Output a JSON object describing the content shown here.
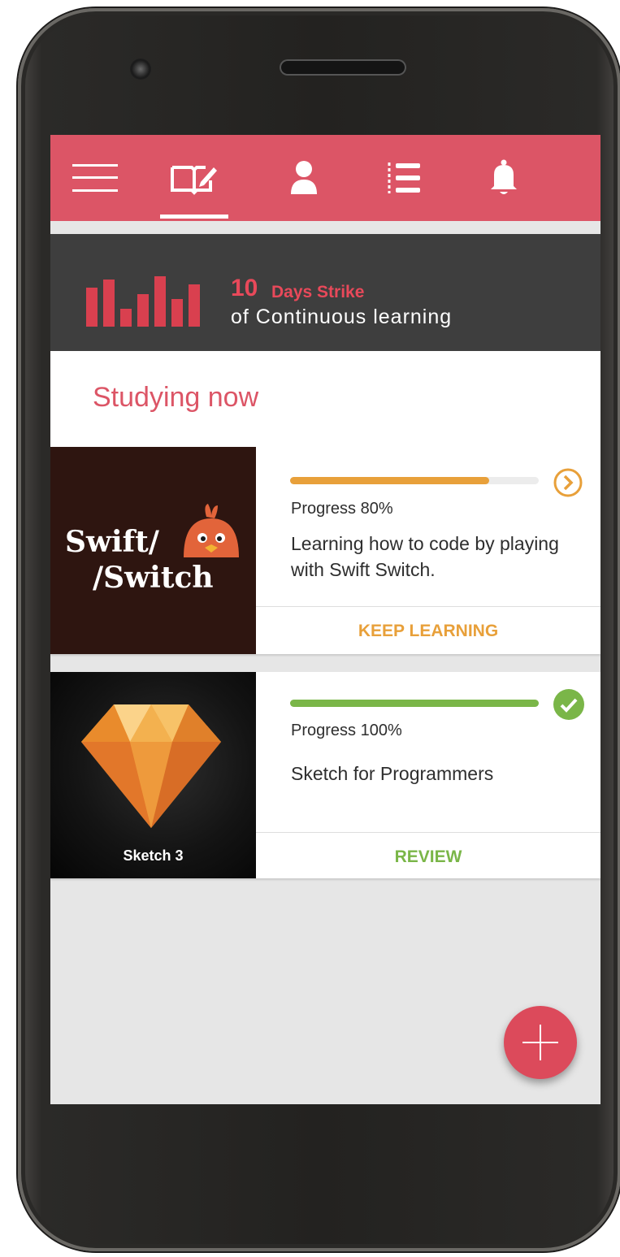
{
  "colors": {
    "brand": "#dc5566",
    "orange_accent": "#e8a03a",
    "green_accent": "#7ab648",
    "dark_banner": "#3e3e3e"
  },
  "nav": {
    "items": [
      {
        "icon": "hamburger-menu-icon",
        "selected": false
      },
      {
        "icon": "open-book-edit-icon",
        "selected": true
      },
      {
        "icon": "user-icon",
        "selected": false
      },
      {
        "icon": "numbered-list-icon",
        "selected": false
      },
      {
        "icon": "bell-icon",
        "selected": false
      }
    ]
  },
  "streak": {
    "icon": "bar-chart-icon",
    "count": "10",
    "days_text": "Days Strike",
    "subtitle": "of Continuous learning"
  },
  "section": {
    "title": "Studying now"
  },
  "courses": [
    {
      "thumbnail_title_line1": "Swift/",
      "thumbnail_title_line2": "/Switch",
      "progress_value": 0.8,
      "progress_label": "Progress 80%",
      "description": "Learning how to code by playing with Swift Switch.",
      "status_icon": "chevron-right-circle-icon",
      "action_label": "KEEP LEARNING",
      "accent": "#e8a03a"
    },
    {
      "thumbnail_caption": "Sketch 3",
      "progress_value": 1.0,
      "progress_label": "Progress 100%",
      "description": "Sketch for Programmers",
      "status_icon": "check-circle-icon",
      "action_label": "REVIEW",
      "accent": "#7ab648"
    }
  ],
  "fab": {
    "icon": "plus-icon"
  }
}
